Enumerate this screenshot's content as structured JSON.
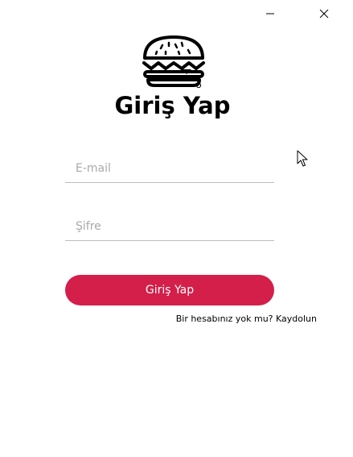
{
  "window": {
    "minimize_icon": "minimize-icon",
    "close_icon": "close-icon"
  },
  "logo": {
    "icon": "burger-logo-icon"
  },
  "title": "Giriş Yap",
  "email": {
    "placeholder": "E-mail",
    "value": ""
  },
  "password": {
    "placeholder": "Şifre",
    "value": ""
  },
  "login_button": {
    "label": "Giriş Yap",
    "color": "#d31f4a"
  },
  "signup_link": "Bir hesabınız yok mu? Kaydolun"
}
